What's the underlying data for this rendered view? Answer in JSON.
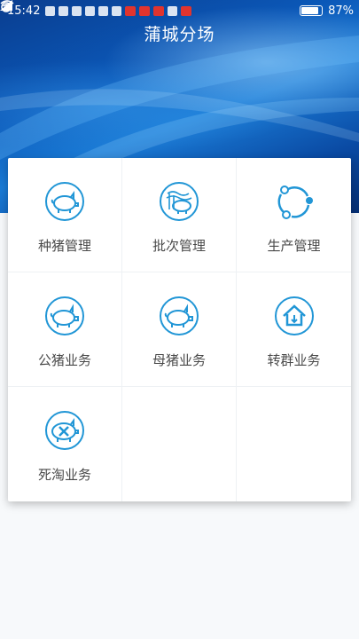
{
  "status_bar": {
    "time": "15:42",
    "battery": "87%",
    "battery_level": 0.87,
    "icons": [
      "alarm-icon",
      "wifi-icon",
      "signal-icon",
      "signal-icon",
      "battery-icon"
    ]
  },
  "header": {
    "title": "蒲城分场"
  },
  "colors": {
    "accent": "#2196d6",
    "label": "#4a4a4a"
  },
  "menu": {
    "items": [
      {
        "label": "种猪管理",
        "icon": "pig-icon"
      },
      {
        "label": "批次管理",
        "icon": "pig-batch-icon"
      },
      {
        "label": "生产管理",
        "icon": "production-cycle-icon"
      },
      {
        "label": "公猪业务",
        "icon": "boar-icon"
      },
      {
        "label": "母猪业务",
        "icon": "sow-icon"
      },
      {
        "label": "转群业务",
        "icon": "house-transfer-icon"
      },
      {
        "label": "死淘业务",
        "icon": "dead-pig-icon"
      }
    ]
  }
}
